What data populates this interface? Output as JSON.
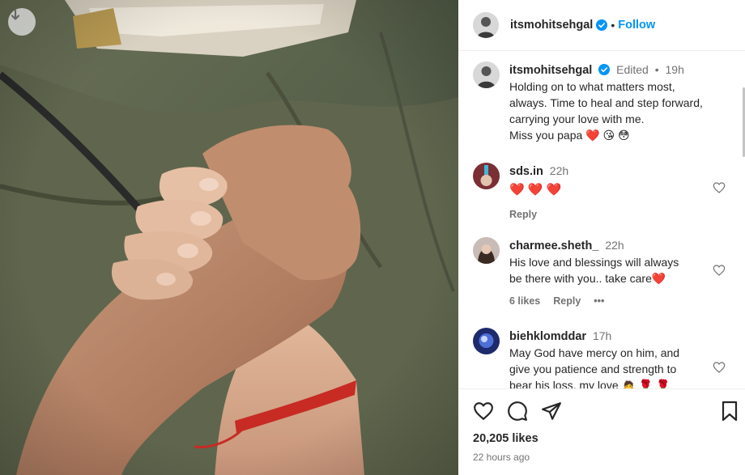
{
  "photo": {
    "download_icon": "download-arrow-icon"
  },
  "header": {
    "username": "itsmohitsehgal",
    "verified_icon": "verified-badge-icon",
    "separator": "•",
    "follow_label": "Follow"
  },
  "caption": {
    "username": "itsmohitsehgal",
    "edited": "Edited",
    "separator": "•",
    "time": "19h",
    "lines": [
      "Holding on to what matters most,",
      "always. Time to heal and step forward,",
      "carrying your love with me."
    ],
    "last_line": "Miss you papa",
    "last_line_emojis": "❤️ 😘 😳"
  },
  "comments": [
    {
      "username": "sds.in",
      "time": "22h",
      "text": "❤️ ❤️ ❤️",
      "reply_label": "Reply"
    },
    {
      "username": "charmee.sheth_",
      "time": "22h",
      "text_lines": [
        "His love and blessings will always",
        "be there with you.. take care❤️"
      ],
      "likes_label": "6 likes",
      "reply_label": "Reply",
      "more_label": "•••"
    },
    {
      "username": "biehklomddar",
      "time": "17h",
      "text_lines": [
        "May God have mercy on him, and",
        "give you patience and strength to",
        "bear his loss, my love 🙇 🌹 🌹"
      ]
    }
  ],
  "actions": {
    "like_icon": "heart-icon",
    "comment_icon": "comment-bubble-icon",
    "share_icon": "paper-plane-icon",
    "save_icon": "bookmark-icon"
  },
  "stats": {
    "likes": "20,205 likes",
    "time_ago": "22 hours ago"
  },
  "colors": {
    "accent": "#0095f6",
    "heart": "#ed2a2a",
    "muted": "#737373",
    "text": "#262626"
  }
}
